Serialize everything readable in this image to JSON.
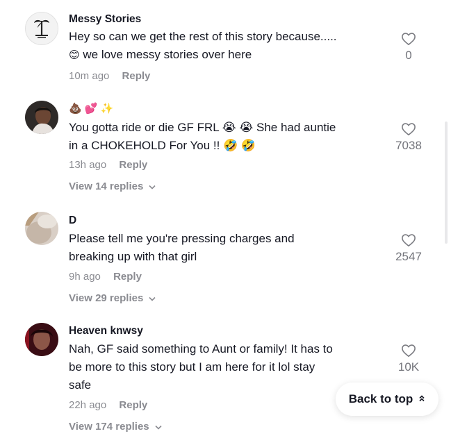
{
  "comments": [
    {
      "username": "Messy Stories",
      "line1": "Hey so can we get the rest of this story because.....",
      "line2": "we love messy stories over here",
      "line2_emoji": "😊",
      "time": "10m ago",
      "reply": "Reply",
      "likes": "0"
    },
    {
      "username_emojis": "💩 💕 ✨",
      "line1": "You gotta ride or die GF FRL 😭 😭  She had auntie",
      "line2": "in a CHOKEHOLD For You !! 🤣 🤣",
      "time": "13h ago",
      "reply": "Reply",
      "view_replies": "View 14 replies",
      "likes": "7038"
    },
    {
      "username": "D",
      "line1": "Please tell me you're pressing charges and",
      "line2": "breaking up with that girl",
      "time": "9h ago",
      "reply": "Reply",
      "view_replies": "View 29 replies",
      "likes": "2547"
    },
    {
      "username": "Heaven knwsy",
      "line1": "Nah, GF said something to Aunt or family! It has to",
      "line2": "be more to this story but I am here for it lol stay",
      "line3": "safe",
      "time": "22h ago",
      "reply": "Reply",
      "view_replies": "View 174 replies",
      "likes": "10K"
    }
  ],
  "back_to_top": "Back to top",
  "icons": {
    "like": "heart-outline-icon",
    "chevron": "chevron-down-icon",
    "up": "double-chevron-up-icon"
  },
  "colors": {
    "text": "#161823",
    "muted": "#8a8b91",
    "count": "#73747b"
  }
}
